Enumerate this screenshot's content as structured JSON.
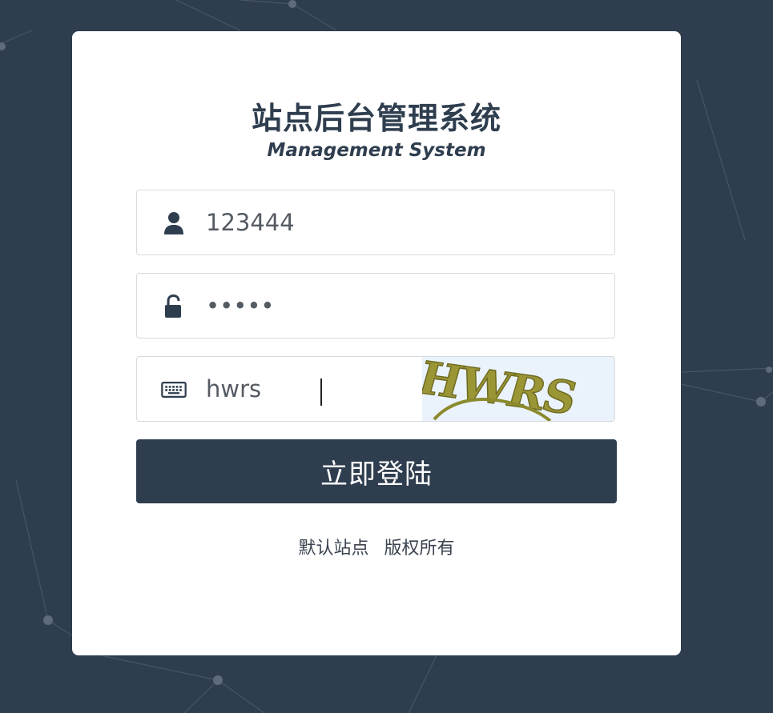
{
  "login": {
    "title": "站点后台管理系统",
    "subtitle": "Management System",
    "username": {
      "value": "123444",
      "icon": "user-icon"
    },
    "password": {
      "value": "•••••",
      "icon": "unlock-icon"
    },
    "captcha": {
      "value": "hwrs",
      "icon": "keyboard-icon",
      "image_text": "HWRS"
    },
    "submit_label": "立即登陆",
    "footer_site": "默认站点",
    "footer_copyright": "版权所有"
  },
  "colors": {
    "background": "#2f3e4f",
    "card": "#ffffff",
    "primary": "#2f3e4f",
    "captcha_text": "#9a9636"
  }
}
